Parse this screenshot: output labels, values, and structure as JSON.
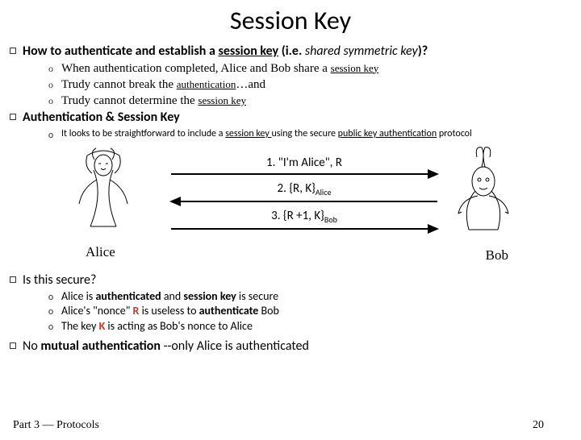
{
  "title": "Session Key",
  "b1": {
    "pre": "How to ",
    "auth": "authenticate",
    "mid": " and ",
    "est": "establish a ",
    "sk": "session key",
    "post": " (i.e. ",
    "ital": "shared symmetric key",
    "post2": ")?"
  },
  "b1s": [
    {
      "pre": "When authentication completed, Alice and Bob share a ",
      "u": "session key",
      "post": ""
    },
    {
      "pre": "Trudy cannot break the ",
      "u": "authentication",
      "post": "…and"
    },
    {
      "pre": "Trudy cannot determine the ",
      "u": "session key",
      "post": ""
    }
  ],
  "b2": "Authentication & Session Key",
  "b2s": {
    "pre": "It looks to be straightforward to include a ",
    "u1": "session key ",
    "mid": "using the secure ",
    "u2": "public key authentication",
    "post": " protocol"
  },
  "diagram": {
    "alice": "Alice",
    "bob": "Bob",
    "msg1": "1. \"I'm Alice\", R",
    "msg2pre": "2. {R, K}",
    "msg2sub": "Alice",
    "msg3pre": "3. {R +1, K}",
    "msg3sub": "Bob"
  },
  "b3": "Is this secure?",
  "b3s": [
    {
      "t": "Alice is <b>authenticated</b> and <b>session key</b> is secure"
    },
    {
      "t": "Alice's \"nonce\" <span class='redtxt'>R</span> is useless to <b>authenticate</b> Bob"
    },
    {
      "t": "The key <span class='redtxt'>K</span> is acting as Bob's nonce to Alice"
    }
  ],
  "b4pre": "No ",
  "b4b": "mutual authentication",
  "b4post": " --only Alice is authenticated",
  "footer": {
    "left": "Part 3 — Protocols",
    "right": "20"
  }
}
